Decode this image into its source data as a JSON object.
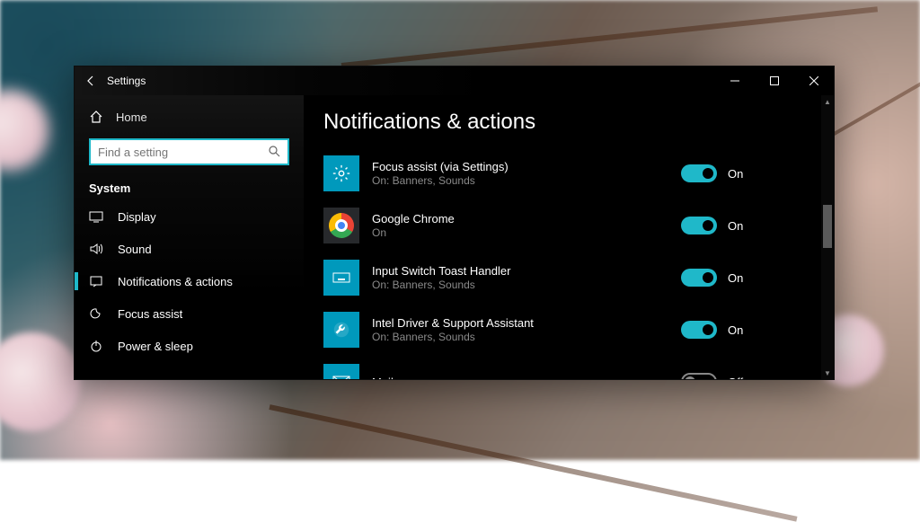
{
  "window": {
    "title": "Settings"
  },
  "sidebar": {
    "home": "Home",
    "search_placeholder": "Find a setting",
    "section": "System",
    "items": [
      {
        "label": "Display"
      },
      {
        "label": "Sound"
      },
      {
        "label": "Notifications & actions"
      },
      {
        "label": "Focus assist"
      },
      {
        "label": "Power & sleep"
      }
    ]
  },
  "page": {
    "title": "Notifications & actions",
    "apps": [
      {
        "name": "Focus assist (via Settings)",
        "sub": "On: Banners, Sounds",
        "state": "On",
        "on": true,
        "icon": "gear"
      },
      {
        "name": "Google Chrome",
        "sub": "On",
        "state": "On",
        "on": true,
        "icon": "chrome"
      },
      {
        "name": "Input Switch Toast Handler",
        "sub": "On: Banners, Sounds",
        "state": "On",
        "on": true,
        "icon": "keyboard"
      },
      {
        "name": "Intel Driver & Support Assistant",
        "sub": "On: Banners, Sounds",
        "state": "On",
        "on": true,
        "icon": "wrench"
      },
      {
        "name": "Mail",
        "sub": "",
        "state": "Off",
        "on": false,
        "icon": "mail"
      }
    ]
  }
}
